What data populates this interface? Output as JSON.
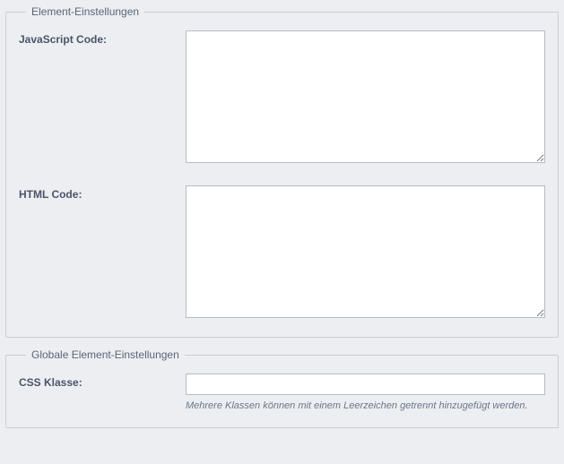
{
  "elementSettings": {
    "legend": "Element-Einstellungen",
    "jsLabel": "JavaScript Code:",
    "jsValue": "",
    "htmlLabel": "HTML Code:",
    "htmlValue": ""
  },
  "globalSettings": {
    "legend": "Globale Element-Einstellungen",
    "cssClassLabel": "CSS Klasse:",
    "cssClassValue": "",
    "cssClassHelp": "Mehrere Klassen können mit einem Leerzeichen getrennt hinzugefügt werden."
  }
}
